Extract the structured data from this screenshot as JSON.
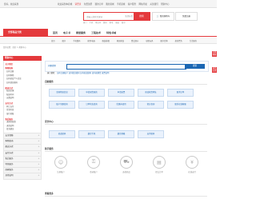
{
  "topbar": {
    "greeting": "您好，欢迎来到",
    "links": [
      {
        "label": "欢迎来到本商城",
        "red": false
      },
      {
        "label": "请登录",
        "red": true
      },
      {
        "label": "免费注册",
        "red": false
      },
      {
        "label": "我的订单",
        "red": false
      },
      {
        "label": "我的商城",
        "red": false
      },
      {
        "label": "手机商城",
        "red": false
      },
      {
        "label": "客户服务",
        "red": false
      },
      {
        "label": "网站导航",
        "red": false
      },
      {
        "label": "关注我们",
        "red": false
      },
      {
        "label": "帮助中心",
        "red": false
      }
    ]
  },
  "header": {
    "search_placeholder": "请输入搜索关键词",
    "search_dropdown": "全部分类",
    "search_button": "搜索",
    "cart_label": "我的购物车",
    "register_label": "免费注册",
    "hotwords": [
      "热门",
      "手机",
      "笔记本",
      "数码",
      "家电",
      "服装",
      "图书"
    ]
  },
  "nav": {
    "category_button": "全部商品分类",
    "items": [
      "首页",
      "电子书",
      "家居服务",
      "工程技术",
      "特色书城"
    ],
    "subnav": [
      "首页",
      "图书",
      "手机数码",
      "家用电器",
      "服装鞋帽",
      "家居家装",
      "食品酒水",
      "母婴玩具",
      "图书音像",
      "旅游票务",
      "生活服务"
    ]
  },
  "breadcrumb": "您的位置：首页 > 帮助中心",
  "sidebar": {
    "title": "帮助中心",
    "group_title": "关于我们",
    "subgroups": [
      {
        "title": "购物指南",
        "items": [
          "如何注册",
          "如何购物",
          "如何修改个人信息",
          "如何找回密码"
        ]
      },
      {
        "title": "配送方式",
        "items": [
          "配送范围",
          "配送时间",
          "运费说明"
        ]
      },
      {
        "title": "支付方式",
        "items": [
          "网上支付",
          "货到付款",
          "银行转账"
        ]
      },
      {
        "title": "售后服务",
        "items": [
          "退换货政策",
          "退款说明",
          "投诉建议"
        ]
      }
    ],
    "sections": [
      "安全保障",
      "购物指南",
      "配送方式",
      "支付方式",
      "售后服务",
      "特色服务",
      "商家服务",
      "其他说明"
    ]
  },
  "main": {
    "search_label": "问题搜索",
    "search_button": "搜索",
    "hot_label": "热门搜索：",
    "hot_items": [
      "如何注册账户",
      "如何找回密码",
      "如何修改密码",
      "如何退换货",
      "发票说明"
    ],
    "services_title": "自助服务",
    "services": [
      "查询物流信息",
      "申请退货退款",
      "申请发票",
      "修改收货地址",
      "取消订单",
      "账户余额查询",
      "订单状态查询",
      "优惠券使用",
      "积分查询",
      "联系在线客服"
    ],
    "safety_title": "安全中心",
    "safety": [
      "修改密码",
      "绑定手机",
      "绑定邮箱",
      "支付密码"
    ],
    "guide_title": "新手服务",
    "guides": [
      "注册账户",
      "登录账户",
      "选择商品",
      "提交订单",
      "在线支付"
    ],
    "more_title": "查看更多"
  },
  "float_tabs": [
    "在线客服",
    "意见反馈"
  ],
  "colors": {
    "brand": "#e4393c",
    "link": "#1a66b3"
  }
}
